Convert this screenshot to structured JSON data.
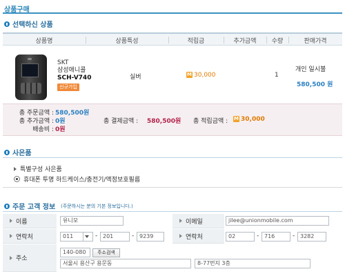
{
  "page": {
    "title": "상품구매"
  },
  "selected_products": {
    "section_title": "선택하신 상품",
    "columns": [
      "상품명",
      "상품특성",
      "적립금",
      "추가금액",
      "수량",
      "판매가격"
    ],
    "item": {
      "carrier": "SKT",
      "model_name": "삼성애니콜",
      "model_code": "SCH-V740",
      "badge": "신규가입",
      "feature": "실버",
      "points_icon": "M",
      "points": "30,000",
      "quantity": "1",
      "price_type": "개인 일시불",
      "price": "580,500 원"
    }
  },
  "summary": {
    "total_order_label": "총 주문금액 :",
    "total_order_value": "580,500원",
    "total_extra_label": "총 추가금액 :",
    "total_extra_value": "0원",
    "shipping_label": "배송비 :",
    "shipping_value": "0원",
    "total_payment_label": "총 결제금액 :",
    "total_payment_value": "580,500원",
    "total_points_label": "총 적립금액 :",
    "total_points_icon": "M",
    "total_points_value": "30,000"
  },
  "gifts": {
    "section_title": "사은품",
    "group_label": "특별구성 사은품",
    "option_label": "휴대폰 투명 하드케이스/충전기/액정보호필름"
  },
  "orderer": {
    "section_title": "주문 고객 정보",
    "section_note": "(주문하시는 분의 기본 정보입니다.)",
    "name_label": "이름",
    "name_value": "유니모",
    "email_label": "이메일",
    "email_value": "jilee@unionmobile.com",
    "phone1_label": "연락처",
    "phone1_prefix": "011",
    "phone1_mid": "201",
    "phone1_last": "9239",
    "phone2_label": "연락처",
    "phone2_prefix": "02",
    "phone2_mid": "716",
    "phone2_last": "3282",
    "address_label": "주소",
    "zip_value": "140-080",
    "zip_button": "주소검색",
    "address1_value": "서울시 용산구 용문동",
    "address2_value": "8-77번지 3층"
  },
  "colors": {
    "accent": "#2a86b8",
    "price_blue": "#2a7fc2",
    "payment_red": "#b2234c",
    "points_orange": "#e07b00",
    "badge_orange": "#f08a3a"
  },
  "icons": {
    "section": "info-bullet-icon",
    "points": "mileage-icon",
    "row_marker": "triangle-bullet-icon"
  }
}
